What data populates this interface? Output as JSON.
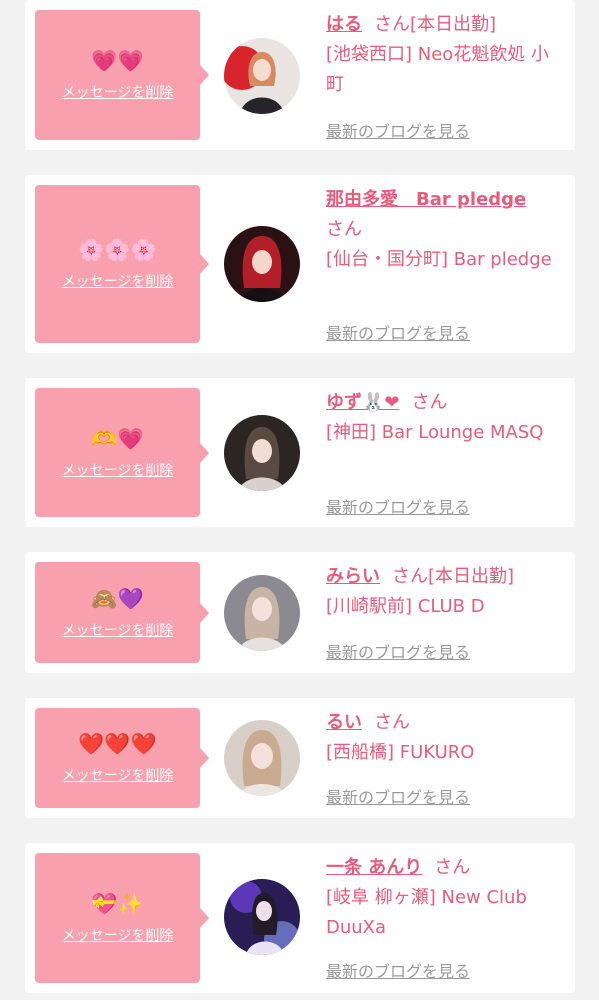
{
  "colors": {
    "page_bg": "#f2f2f2",
    "card_bg": "#ffffff",
    "bubble_bg": "#f8a0ad",
    "name_pink": "#ea5a7a",
    "blog_gray": "#9a9a9a"
  },
  "favorites": [
    {
      "stamp": "💗💗",
      "delete_label": "メッセージを削除",
      "name": "はる",
      "suffix": "さん",
      "status": "[本日出勤]",
      "shop": "[池袋西口] Neo花魁飲処 小町",
      "blog_label": "最新のブログを見る"
    },
    {
      "stamp": "🌸🌸🌸",
      "delete_label": "メッセージを削除",
      "name": "那由多愛　Bar pledge",
      "suffix": "さん",
      "status": "",
      "shop": "[仙台・国分町] Bar pledge",
      "blog_label": "最新のブログを見る"
    },
    {
      "stamp": "🫶💗",
      "delete_label": "メッセージを削除",
      "name": "ゆず🐰❤",
      "suffix": "さん",
      "status": "",
      "shop": "[神田] Bar Lounge MASQ",
      "blog_label": "最新のブログを見る"
    },
    {
      "stamp": "🙈💜",
      "delete_label": "メッセージを削除",
      "name": "みらい",
      "suffix": "さん",
      "status": "[本日出勤]",
      "shop": "[川崎駅前] CLUB D",
      "blog_label": "最新のブログを見る"
    },
    {
      "stamp": "❤️❤️❤️",
      "delete_label": "メッセージを削除",
      "name": "るい",
      "suffix": "さん",
      "status": "",
      "shop": "[西船橋] FUKURO",
      "blog_label": "最新のブログを見る"
    },
    {
      "stamp": "💝✨",
      "delete_label": "メッセージを削除",
      "name": "一条 あんり",
      "suffix": "さん",
      "status": "",
      "shop": "[岐阜 柳ヶ瀬] New Club DuuXa",
      "blog_label": "最新のブログを見る"
    }
  ]
}
